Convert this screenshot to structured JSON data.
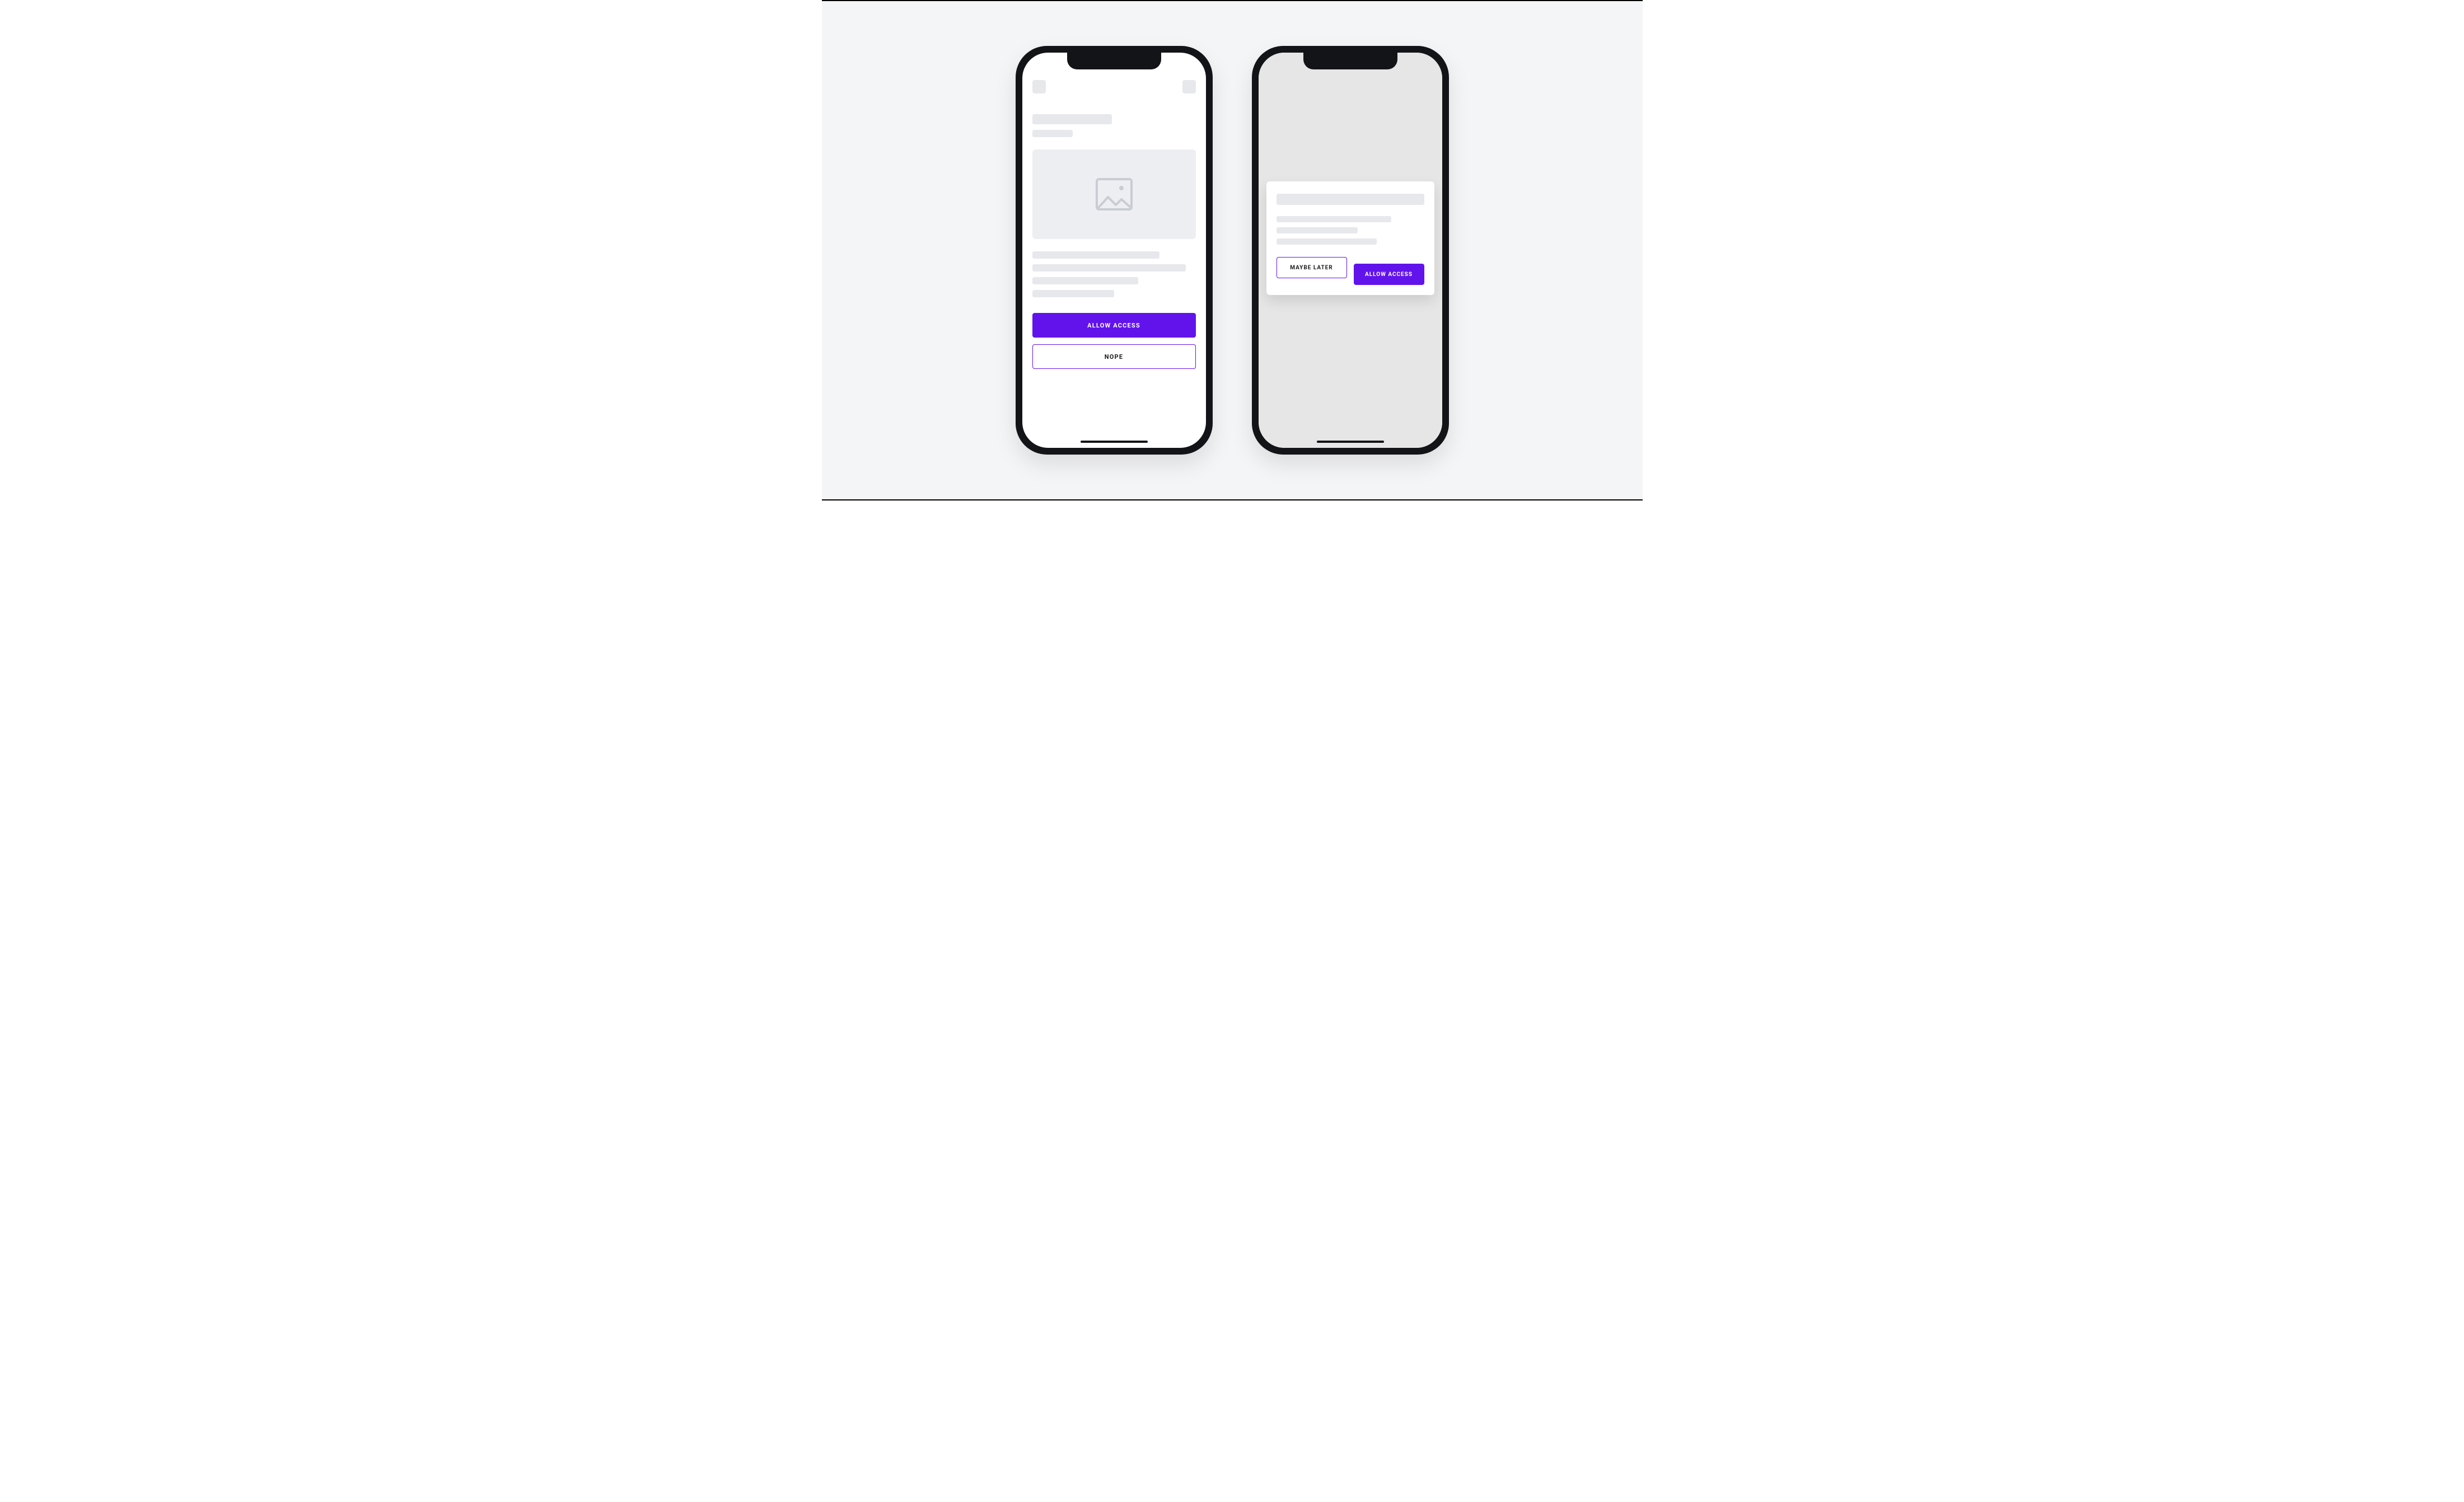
{
  "colors": {
    "accent": "#6213ec",
    "canvas_bg": "#f4f5f7",
    "placeholder": "#e7e8ec"
  },
  "screen_a": {
    "primary_label": "ALLOW ACCESS",
    "secondary_label": "NOPE"
  },
  "screen_b": {
    "dialog": {
      "decline_label": "MAYBE LATER",
      "accept_label": "ALLOW ACCESS"
    }
  }
}
